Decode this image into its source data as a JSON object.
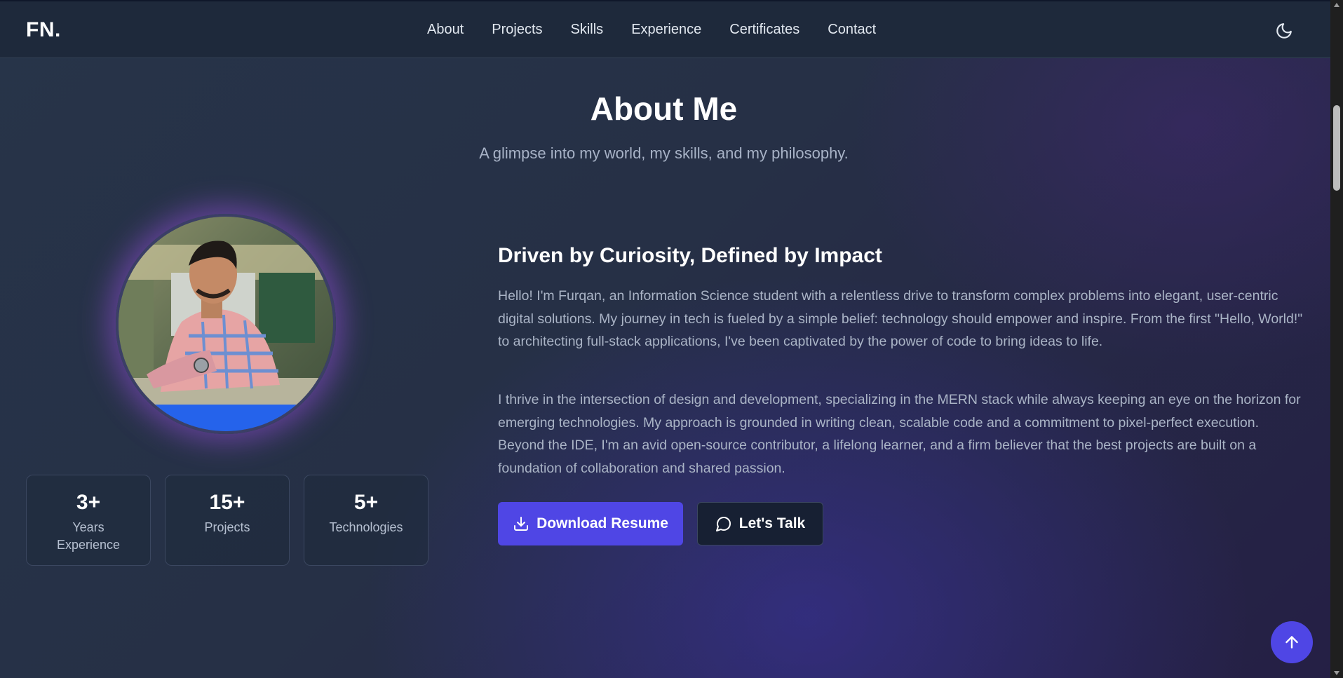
{
  "navbar": {
    "logo": "FN.",
    "links": [
      {
        "label": "About"
      },
      {
        "label": "Projects"
      },
      {
        "label": "Skills"
      },
      {
        "label": "Experience"
      },
      {
        "label": "Certificates"
      },
      {
        "label": "Contact"
      }
    ],
    "theme_icon": "moon-icon"
  },
  "about": {
    "title": "About Me",
    "subtitle": "A glimpse into my world, my skills, and my philosophy.",
    "headline": "Driven by Curiosity, Defined by Impact",
    "paragraphs": [
      "Hello! I'm Furqan, an Information Science student with a relentless drive to transform complex problems into elegant, user-centric digital solutions. My journey in tech is fueled by a simple belief: technology should empower and inspire. From the first \"Hello, World!\" to architecting full-stack applications, I've been captivated by the power of code to bring ideas to life.",
      "I thrive in the intersection of design and development, specializing in the MERN stack while always keeping an eye on the horizon for emerging technologies. My approach is grounded in writing clean, scalable code and a commitment to pixel-perfect execution. Beyond the IDE, I'm an avid open-source contributor, a lifelong learner, and a firm believer that the best projects are built on a foundation of collaboration and shared passion."
    ],
    "stats": [
      {
        "value": "3+",
        "label": "Years Experience"
      },
      {
        "value": "15+",
        "label": "Projects"
      },
      {
        "value": "5+",
        "label": "Technologies"
      }
    ],
    "buttons": {
      "resume_label": "Download Resume",
      "resume_icon": "download-icon",
      "talk_label": "Let's Talk",
      "talk_icon": "message-circle-icon"
    }
  },
  "back_to_top_icon": "arrow-up-icon",
  "colors": {
    "accent": "#4f46e5",
    "navbar_bg": "#1e293b",
    "glow": "#a855f7"
  }
}
